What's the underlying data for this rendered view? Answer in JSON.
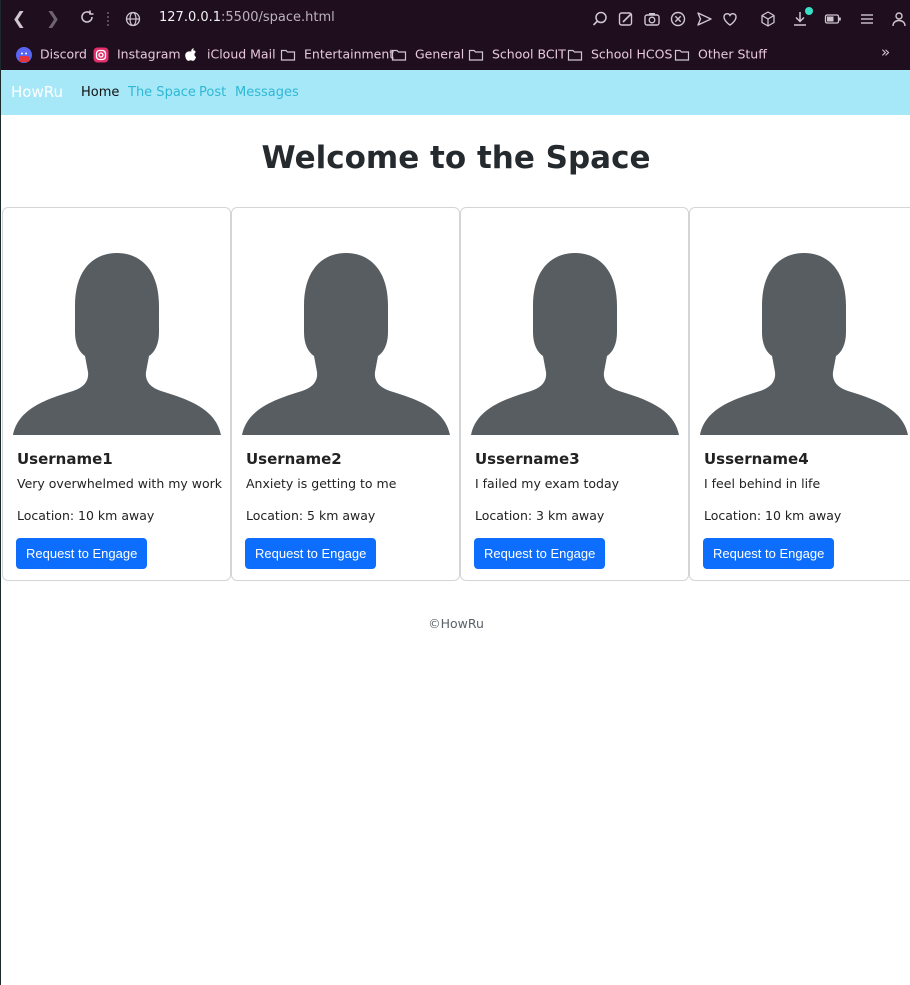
{
  "browser": {
    "url_host": "127.0.0.1",
    "url_path": ":5500/space.html",
    "bookmarks": [
      {
        "label": "Discord",
        "icon": "discord-icon"
      },
      {
        "label": "Instagram",
        "icon": "instagram-icon"
      },
      {
        "label": "iCloud Mail",
        "icon": "apple-icon"
      },
      {
        "label": "Entertainment",
        "icon": "folder-icon"
      },
      {
        "label": "General",
        "icon": "folder-icon"
      },
      {
        "label": "School BCIT",
        "icon": "folder-icon"
      },
      {
        "label": "School HCOS",
        "icon": "folder-icon"
      },
      {
        "label": "Other Stuff",
        "icon": "folder-icon"
      }
    ],
    "more_label": "»"
  },
  "navbar": {
    "brand": "HowRu",
    "links": [
      "Home",
      "The Space",
      "Post",
      "Messages"
    ],
    "active": "Home",
    "bg_color": "#a6e8f8"
  },
  "main": {
    "title": "Welcome to the Space",
    "cards": [
      {
        "username": "Username1",
        "status": "Very overwhelmed with my work",
        "location": "Location: 10 km away",
        "button": "Request to Engage"
      },
      {
        "username": "Username2",
        "status": "Anxiety is getting to me",
        "location": "Location: 5 km away",
        "button": "Request to Engage"
      },
      {
        "username": "Ussername3",
        "status": "I failed my exam today",
        "location": "Location: 3 km away",
        "button": "Request to Engage"
      },
      {
        "username": "Ussername4",
        "status": "I feel behind in life",
        "location": "Location: 10 km away",
        "button": "Request to Engage"
      }
    ]
  },
  "footer": {
    "text": "©HowRu"
  },
  "colors": {
    "accent": "#0d6efd",
    "chrome": "#1e0e1e",
    "avatar": "#575d61"
  }
}
